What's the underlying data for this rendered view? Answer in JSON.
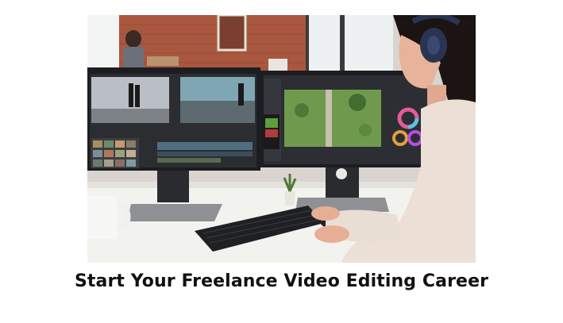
{
  "caption": "Start Your Freelance Video Editing Career",
  "colors": {
    "wall": "#a9573f",
    "window": "#eef1f2",
    "desk": "#f2f2ef",
    "monitor": "#1c1d20",
    "sweater": "#ece0d6",
    "skin": "#e8b39b",
    "hair": "#1b1412",
    "headphones": "#2a3452"
  },
  "icons": [
    "color-wheel-icon"
  ]
}
